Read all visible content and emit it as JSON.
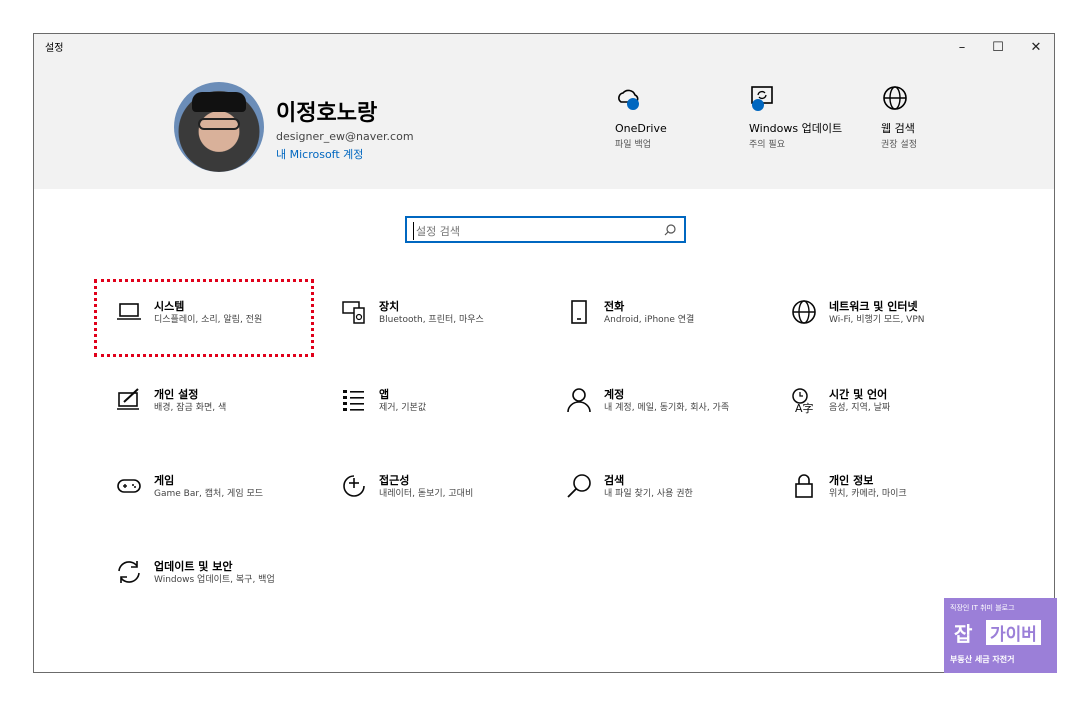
{
  "window": {
    "title": "설정",
    "minimize": "–",
    "maximize": "☐",
    "close": "✕"
  },
  "header": {
    "user_name": "이정호노랑",
    "user_email": "designer_ew@naver.com",
    "ms_account_link": "내 Microsoft 계정",
    "quick_links": [
      {
        "icon": "onedrive-cloud-icon",
        "label": "OneDrive",
        "sub": "파일 백업"
      },
      {
        "icon": "windows-update-icon",
        "label": "Windows 업데이트",
        "sub": "주의 필요"
      },
      {
        "icon": "globe-icon",
        "label": "웹 검색",
        "sub": "권장 설정"
      }
    ]
  },
  "search": {
    "placeholder": "설정 검색"
  },
  "categories": [
    {
      "icon": "laptop-icon",
      "label": "시스템",
      "sub": "디스플레이, 소리, 알림, 전원"
    },
    {
      "icon": "keyboard-device-icon",
      "label": "장치",
      "sub": "Bluetooth, 프린터, 마우스"
    },
    {
      "icon": "phone-icon",
      "label": "전화",
      "sub": "Android, iPhone 연결"
    },
    {
      "icon": "globe-network-icon",
      "label": "네트워크 및 인터넷",
      "sub": "Wi-Fi, 비행기 모드, VPN"
    },
    {
      "icon": "personalization-brush-icon",
      "label": "개인 설정",
      "sub": "배경, 잠금 화면, 색"
    },
    {
      "icon": "apps-list-icon",
      "label": "앱",
      "sub": "제거, 기본값"
    },
    {
      "icon": "person-icon",
      "label": "계정",
      "sub": "내 계정, 메일, 동기화, 회사, 가족"
    },
    {
      "icon": "time-language-icon",
      "label": "시간 및 언어",
      "sub": "음성, 지역, 날짜"
    },
    {
      "icon": "gamepad-icon",
      "label": "게임",
      "sub": "Game Bar, 캡처, 게임 모드"
    },
    {
      "icon": "accessibility-icon",
      "label": "접근성",
      "sub": "내레이터, 돋보기, 고대비"
    },
    {
      "icon": "search-magnifier-icon",
      "label": "검색",
      "sub": "내 파일 찾기, 사용 권한"
    },
    {
      "icon": "lock-icon",
      "label": "개인 정보",
      "sub": "위치, 카메라, 마이크"
    },
    {
      "icon": "update-sync-icon",
      "label": "업데이트 및 보안",
      "sub": "Windows 업데이트, 복구, 백업"
    }
  ],
  "watermark": {
    "tagline": "직장인 IT 취미 블로그",
    "logo_left": "잡",
    "logo_right": "가이버",
    "bottom": "부동산 세금 자전거"
  },
  "colors": {
    "accent": "#0067c0",
    "highlight": "#e0001a",
    "header_bg": "#f2f2f2",
    "badge": "#9b7fd8"
  }
}
